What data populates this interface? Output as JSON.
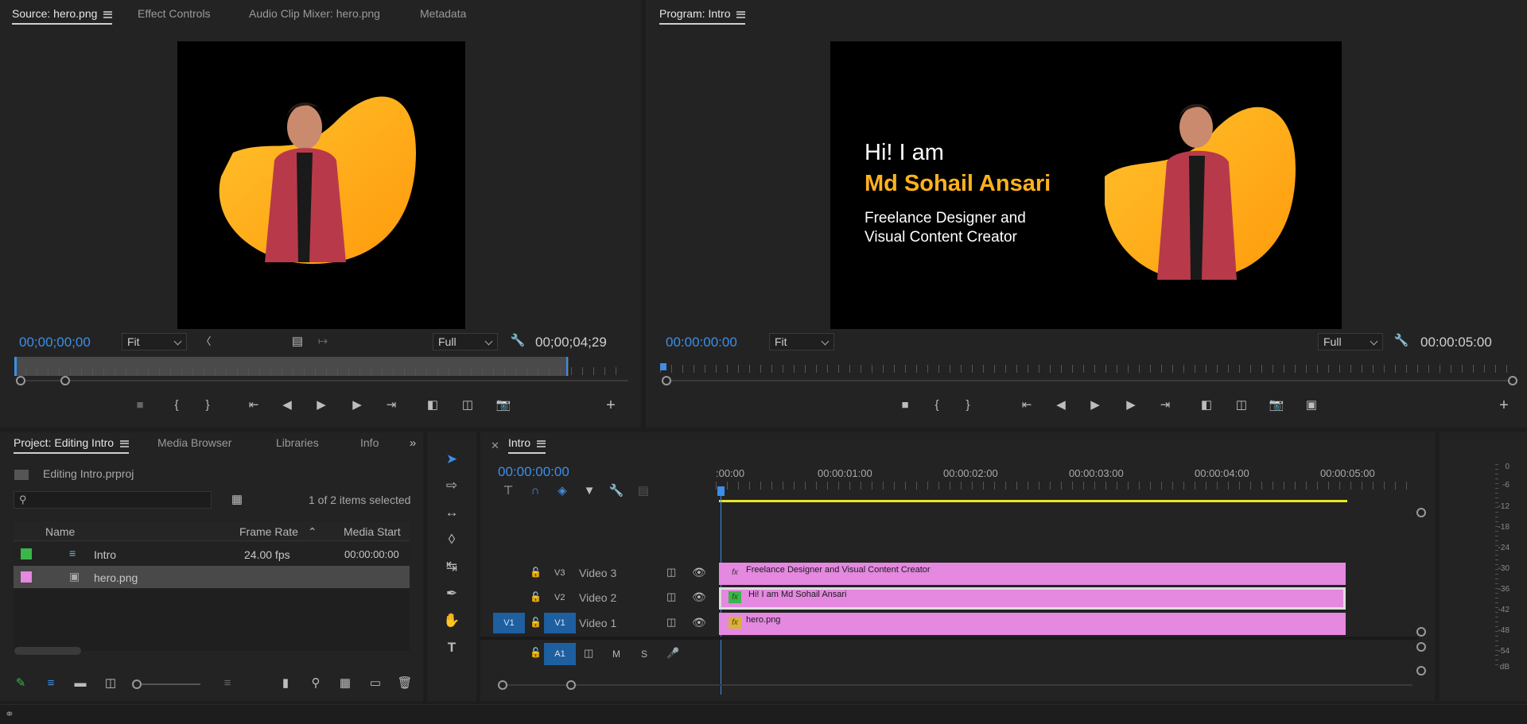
{
  "source_panel": {
    "tabs": [
      "Source: hero.png",
      "Effect Controls",
      "Audio Clip Mixer: hero.png",
      "Metadata"
    ],
    "timecode_in": "00;00;00;00",
    "zoom": "Fit",
    "resolution": "Full",
    "duration": "00;00;04;29"
  },
  "program_panel": {
    "tab": "Program: Intro",
    "timecode_in": "00:00:00:00",
    "zoom": "Fit",
    "resolution": "Full",
    "duration": "00:00:05:00",
    "frame": {
      "line1": "Hi! I am",
      "line2": "Md Sohail Ansari",
      "line3": "Freelance Designer and",
      "line4": "Visual Content Creator",
      "accent": "#ffb21c"
    }
  },
  "project_panel": {
    "tabs": [
      "Project: Editing Intro",
      "Media Browser",
      "Libraries",
      "Info"
    ],
    "file": "Editing Intro.prproj",
    "selected_count": "1 of 2 items selected",
    "columns": [
      "Name",
      "Frame Rate",
      "Media Start"
    ],
    "items": [
      {
        "name": "Intro",
        "frame_rate": "24.00 fps",
        "media_start": "00:00:00:00",
        "color": "#3cb54a"
      },
      {
        "name": "hero.png",
        "frame_rate": "",
        "media_start": "",
        "color": "#e488e0"
      }
    ]
  },
  "timeline": {
    "tab": "Intro",
    "timecode": "00:00:00:00",
    "ruler": [
      ":00:00",
      "00:00:01:00",
      "00:00:02:00",
      "00:00:03:00",
      "00:00:04:00",
      "00:00:05:00"
    ],
    "tracks": [
      {
        "id": "V3",
        "name": "Video 3",
        "clip": "Freelance Designer and  Visual Content Creator"
      },
      {
        "id": "V2",
        "name": "Video 2",
        "clip": "Hi! I am Md Sohail Ansari"
      },
      {
        "id": "V1",
        "name": "Video 1",
        "clip": "hero.png",
        "src": "V1"
      }
    ],
    "audio": {
      "id": "A1",
      "m": "M",
      "s": "S"
    }
  },
  "meter": {
    "labels": [
      "0",
      "-6",
      "-12",
      "-18",
      "-24",
      "-30",
      "-36",
      "-42",
      "-48",
      "-54",
      "dB"
    ]
  },
  "colors": {
    "clip": "#e488e0",
    "timecode": "#3d8ee6",
    "work_area": "#e6e62a"
  }
}
